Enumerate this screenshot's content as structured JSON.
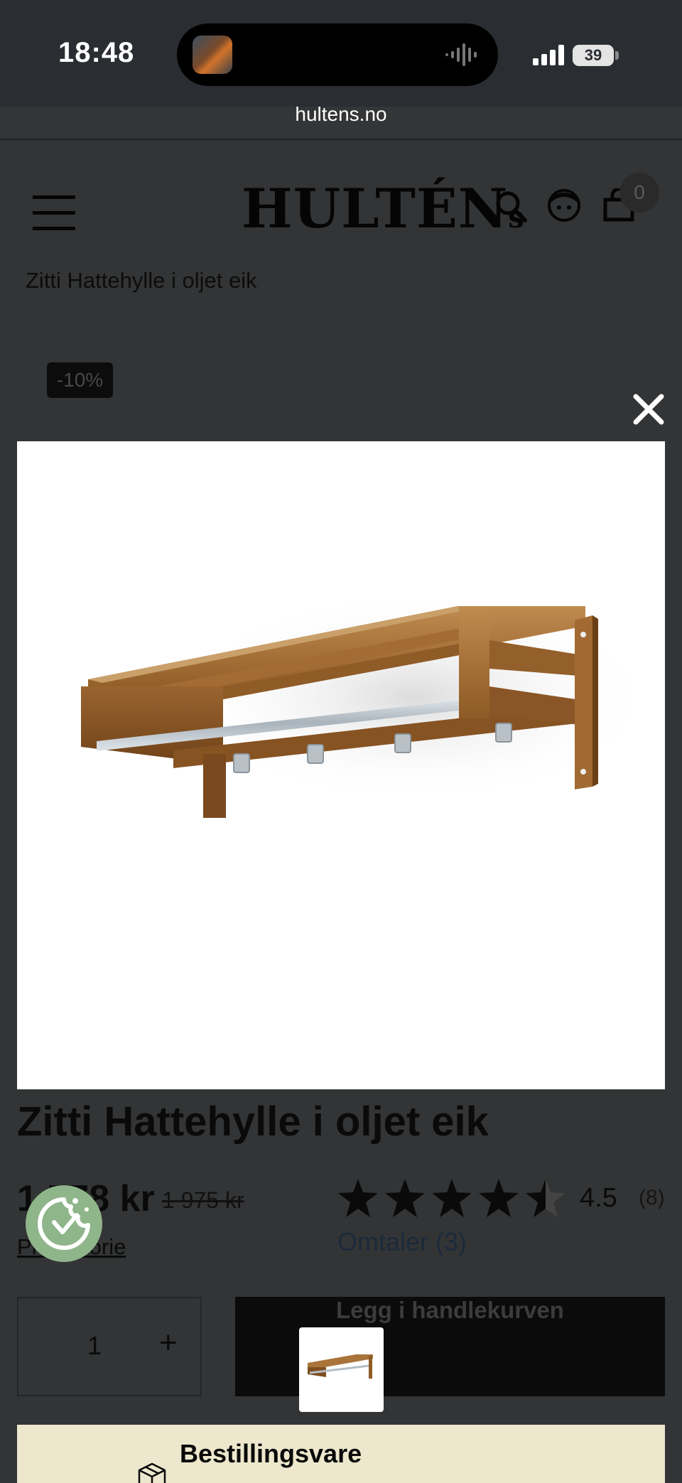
{
  "status_bar": {
    "time": "18:48",
    "battery": "39",
    "url": "hultens.no"
  },
  "header": {
    "logo": "HULTÉN",
    "logo_suffix": "s",
    "cart_count": "0"
  },
  "breadcrumb": "Zitti Hattehylle i oljet eik",
  "badge": "-10%",
  "product": {
    "title": "Zitti Hattehylle i oljet eik",
    "price": "1 778 kr",
    "old_price": "1 975 kr",
    "rating": "4.5",
    "rating_value": 4.5,
    "rating_count": "(8)",
    "price_history_label": "Prishistorie",
    "reviews_label": "Omtaler (3)"
  },
  "purchase": {
    "quantity": "1",
    "plus_label": "+",
    "add_to_cart_label": "Legg i handlekurven"
  },
  "order_banner": {
    "title": "Bestillingsvare"
  },
  "colors": {
    "overlay": "#333435",
    "banner": "#ede8cd",
    "cookie": "#8fb58a",
    "oak": "#a9743a"
  },
  "icons": [
    "hamburger-icon",
    "search-icon",
    "account-icon",
    "bag-icon",
    "star-icon",
    "close-icon",
    "cookie-icon",
    "box-icon"
  ]
}
